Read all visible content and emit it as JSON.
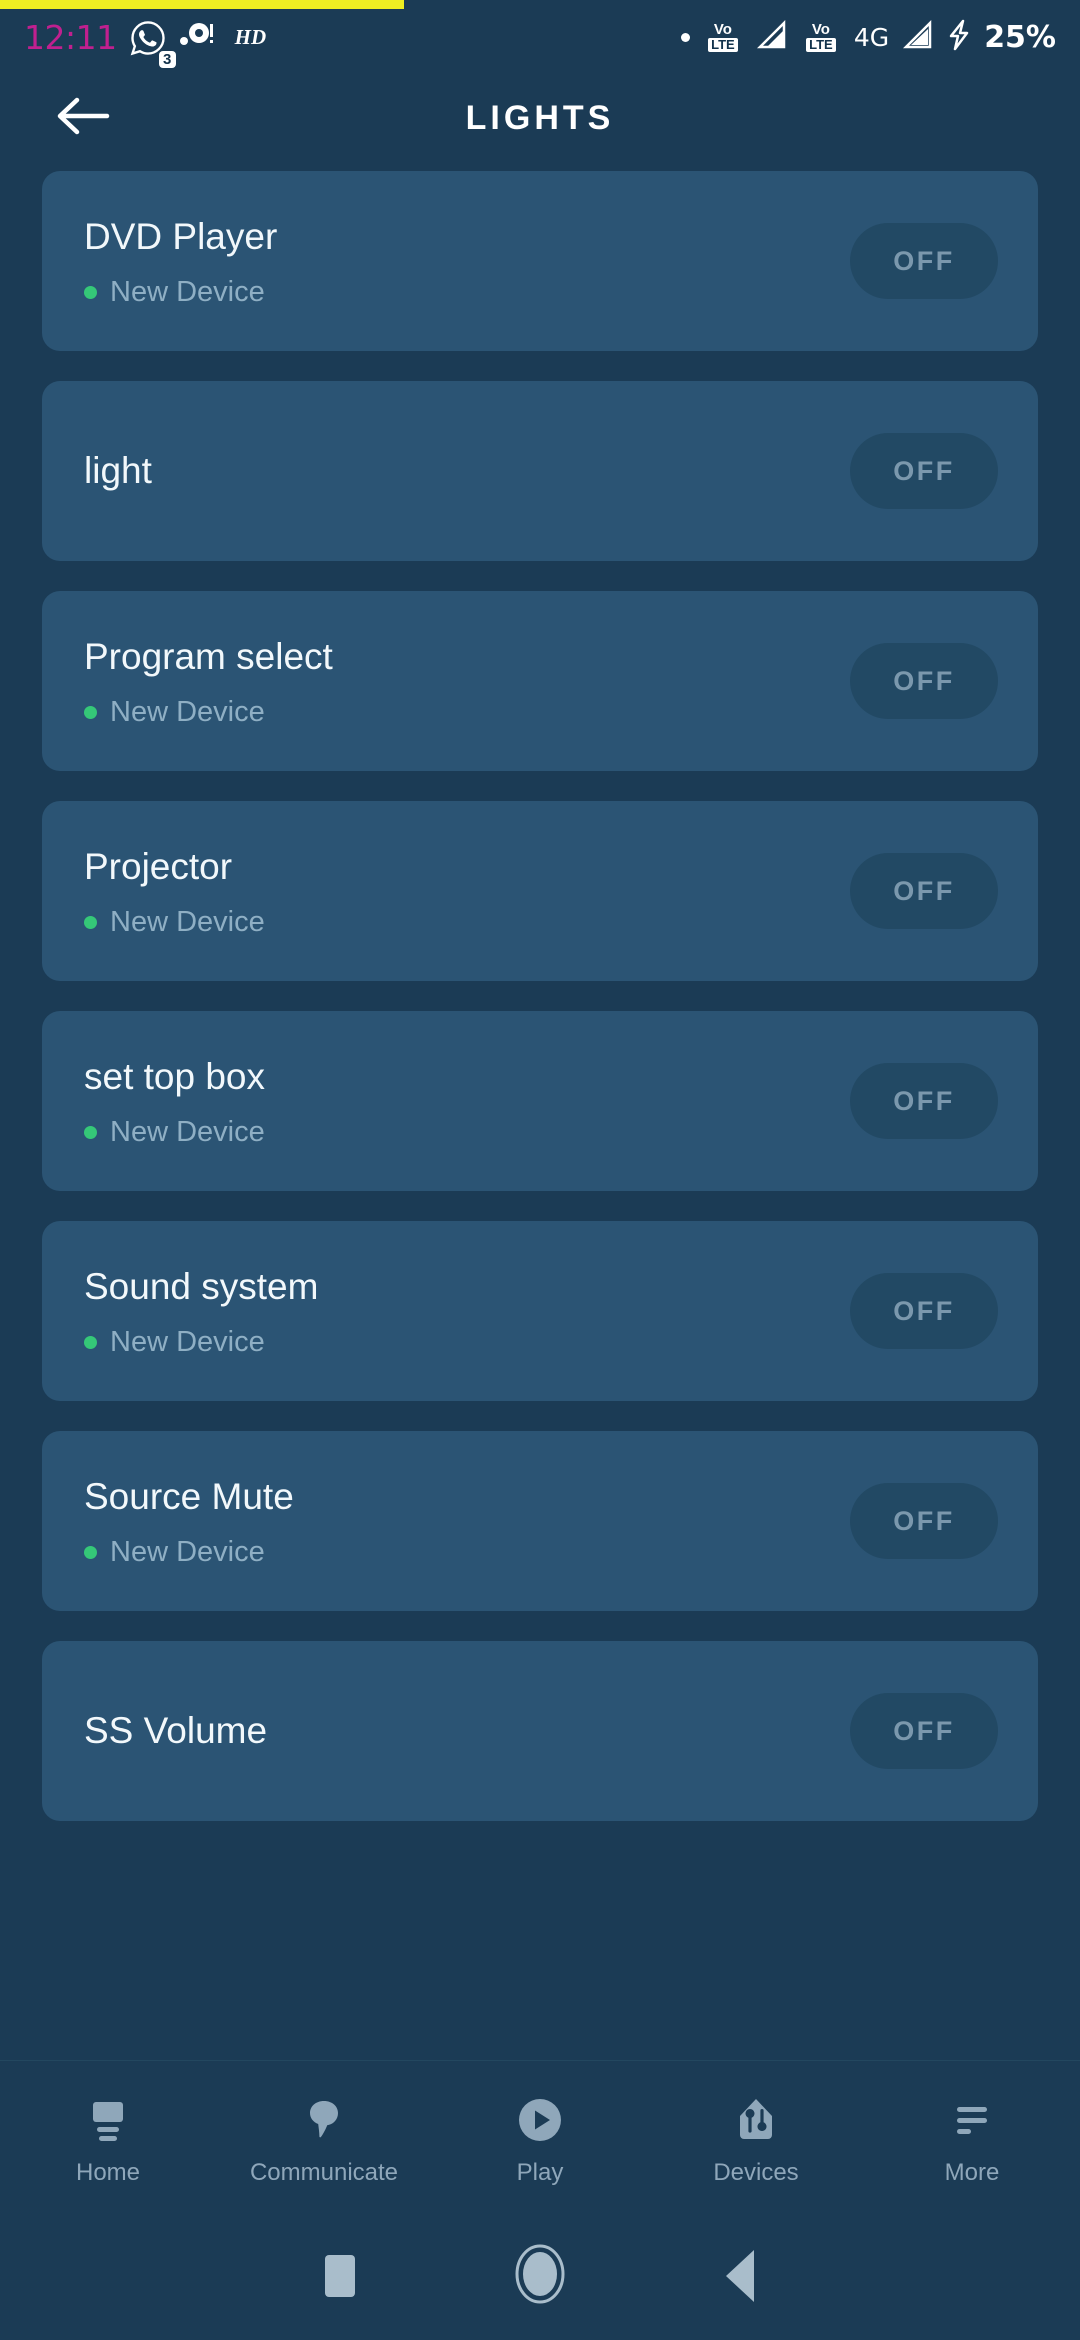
{
  "status_bar": {
    "time": "12:11",
    "whatsapp_badge": "3",
    "hd_label": "HD",
    "volte_vo": "Vo",
    "volte_lte": "LTE",
    "network": "4G",
    "battery": "25%",
    "icons": [
      "whatsapp-icon",
      "camera-icon",
      "hd-icon",
      "dot-icon",
      "volte-icon",
      "signal-icon",
      "volte-icon-2",
      "signal-icon-2",
      "charging-bolt-icon"
    ]
  },
  "app_bar": {
    "title": "LIGHTS",
    "back_icon": "arrow-left-icon"
  },
  "devices": [
    {
      "name": "DVD Player",
      "subtitle": "New Device",
      "state": "OFF",
      "has_subtitle": true
    },
    {
      "name": "light",
      "subtitle": "",
      "state": "OFF",
      "has_subtitle": false
    },
    {
      "name": "Program select",
      "subtitle": "New Device",
      "state": "OFF",
      "has_subtitle": true
    },
    {
      "name": "Projector",
      "subtitle": "New Device",
      "state": "OFF",
      "has_subtitle": true
    },
    {
      "name": "set top box",
      "subtitle": "New Device",
      "state": "OFF",
      "has_subtitle": true
    },
    {
      "name": "Sound system",
      "subtitle": "New Device",
      "state": "OFF",
      "has_subtitle": true
    },
    {
      "name": "Source Mute",
      "subtitle": "New Device",
      "state": "OFF",
      "has_subtitle": true
    },
    {
      "name": "SS Volume",
      "subtitle": "",
      "state": "OFF",
      "has_subtitle": false
    }
  ],
  "tab_bar": {
    "items": [
      {
        "label": "Home",
        "icon": "tv-icon"
      },
      {
        "label": "Communicate",
        "icon": "speech-bubble-icon"
      },
      {
        "label": "Play",
        "icon": "play-circle-icon"
      },
      {
        "label": "Devices",
        "icon": "house-pin-icon"
      },
      {
        "label": "More",
        "icon": "menu-lines-icon"
      }
    ]
  },
  "android_nav": {
    "recents": "square-icon",
    "home": "circle-icon",
    "back": "triangle-left-icon"
  },
  "colors": {
    "background": "#1b3b55",
    "card": "#2b5474",
    "accent_green": "#35c878",
    "time_pink": "#c0208f",
    "off_button": "#224964",
    "muted_text": "#8fafc4"
  }
}
